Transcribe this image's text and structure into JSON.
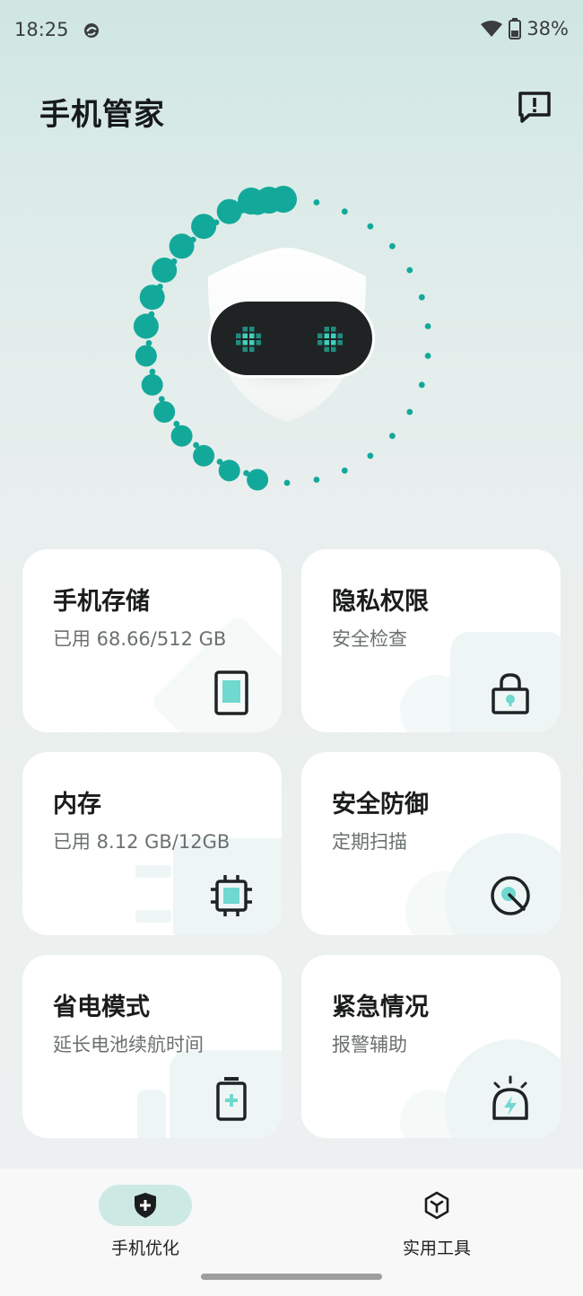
{
  "status_bar": {
    "time": "18:25",
    "battery": "38%"
  },
  "header": {
    "title": "手机管家",
    "feedback_icon": "feedback-icon"
  },
  "colors": {
    "accent": "#13a99a",
    "card_bg": "#ffffff",
    "teal_light": "#6fd8cf",
    "dark": "#1f2323"
  },
  "cards": [
    {
      "title": "手机存储",
      "subtitle": "已用 68.66/512 GB",
      "icon": "storage-icon"
    },
    {
      "title": "隐私权限",
      "subtitle": "安全检查",
      "icon": "lock-icon"
    },
    {
      "title": "内存",
      "subtitle": "已用 8.12 GB/12GB",
      "icon": "chip-icon"
    },
    {
      "title": "安全防御",
      "subtitle": "定期扫描",
      "icon": "scan-icon"
    },
    {
      "title": "省电模式",
      "subtitle": "延长电池续航时间",
      "icon": "battery-icon"
    },
    {
      "title": "紧急情况",
      "subtitle": "报警辅助",
      "icon": "alarm-icon"
    }
  ],
  "nav": [
    {
      "label": "手机优化",
      "icon": "shield-plus-icon",
      "active": true
    },
    {
      "label": "实用工具",
      "icon": "toolbox-icon",
      "active": false
    }
  ]
}
